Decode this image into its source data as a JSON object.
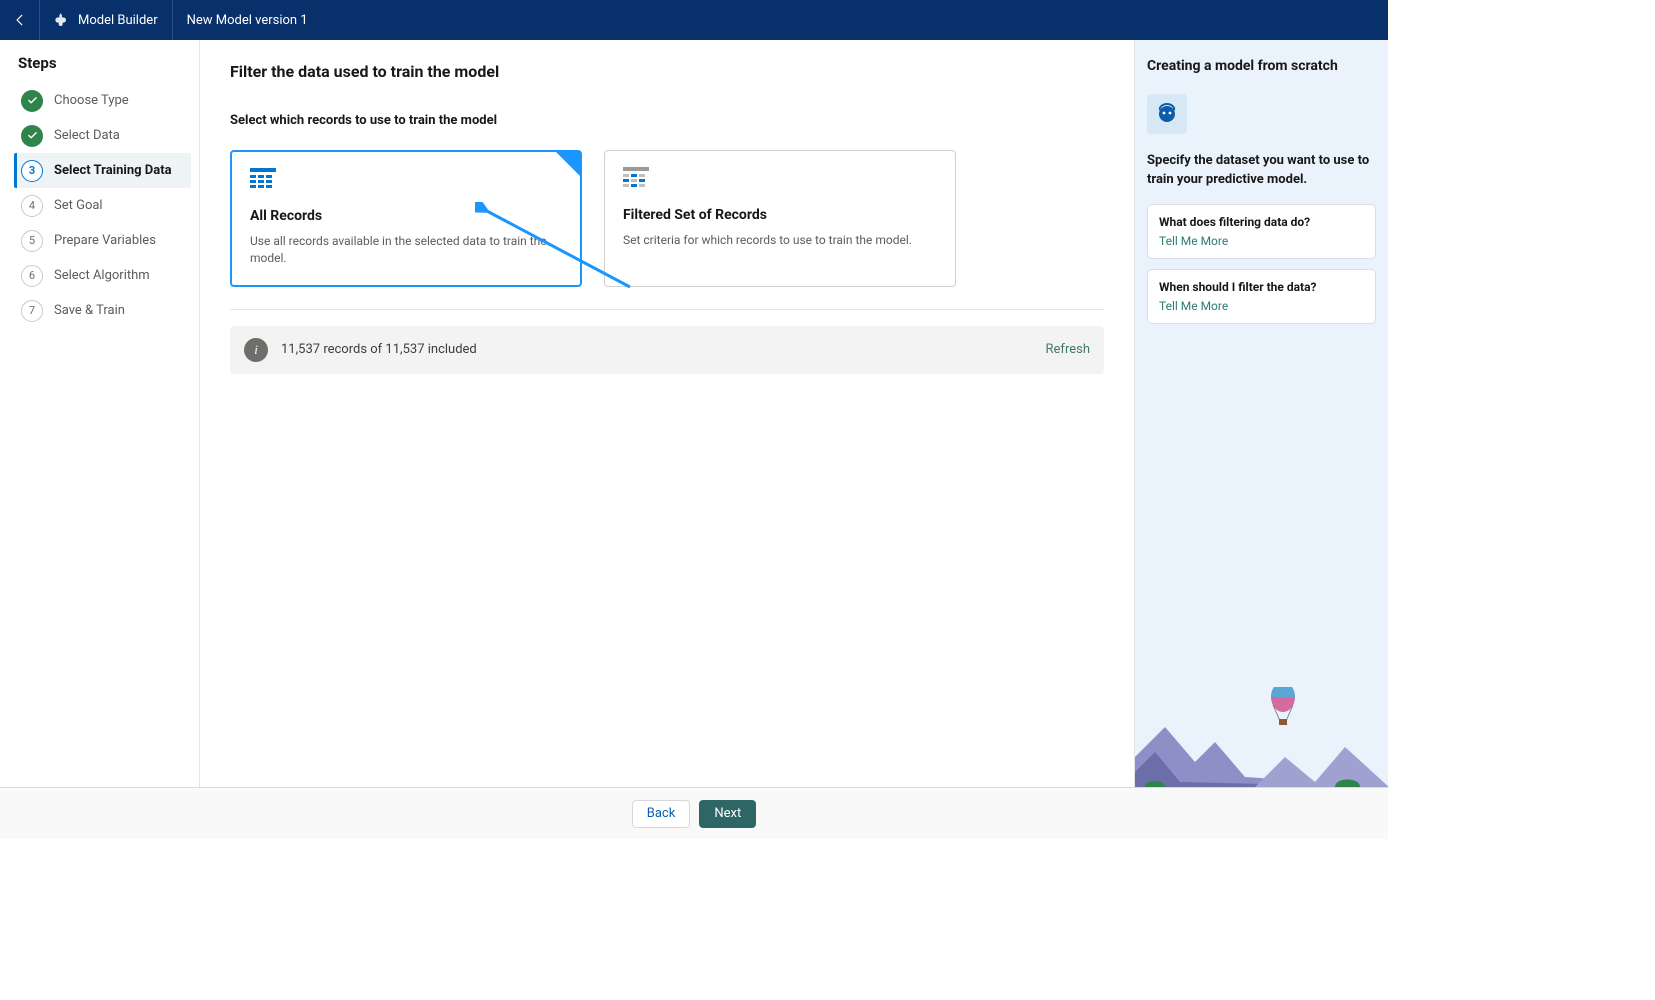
{
  "topbar": {
    "app_name": "Model Builder",
    "model_name": "New Model version 1"
  },
  "sidebar": {
    "heading": "Steps",
    "items": [
      {
        "label": "Choose Type"
      },
      {
        "label": "Select Data"
      },
      {
        "label": "Select Training Data"
      },
      {
        "label": "Set Goal"
      },
      {
        "label": "Prepare Variables"
      },
      {
        "label": "Select Algorithm"
      },
      {
        "label": "Save & Train"
      }
    ]
  },
  "content": {
    "title": "Filter the data used to train the model",
    "prompt": "Select which records to use to train the model",
    "cards": [
      {
        "title": "All Records",
        "desc": "Use all records available in the selected data to train the model."
      },
      {
        "title": "Filtered Set of Records",
        "desc": "Set criteria for which records to use to train the model."
      }
    ],
    "info": "11,537 records of 11,537 included",
    "refresh": "Refresh"
  },
  "help": {
    "heading": "Creating a model from scratch",
    "subtitle": "Specify the dataset you want to use to train your predictive model.",
    "cards": [
      {
        "q": "What does filtering data do?",
        "more": "Tell Me More"
      },
      {
        "q": "When should I filter the data?",
        "more": "Tell Me More"
      }
    ]
  },
  "footer": {
    "back": "Back",
    "next": "Next"
  }
}
